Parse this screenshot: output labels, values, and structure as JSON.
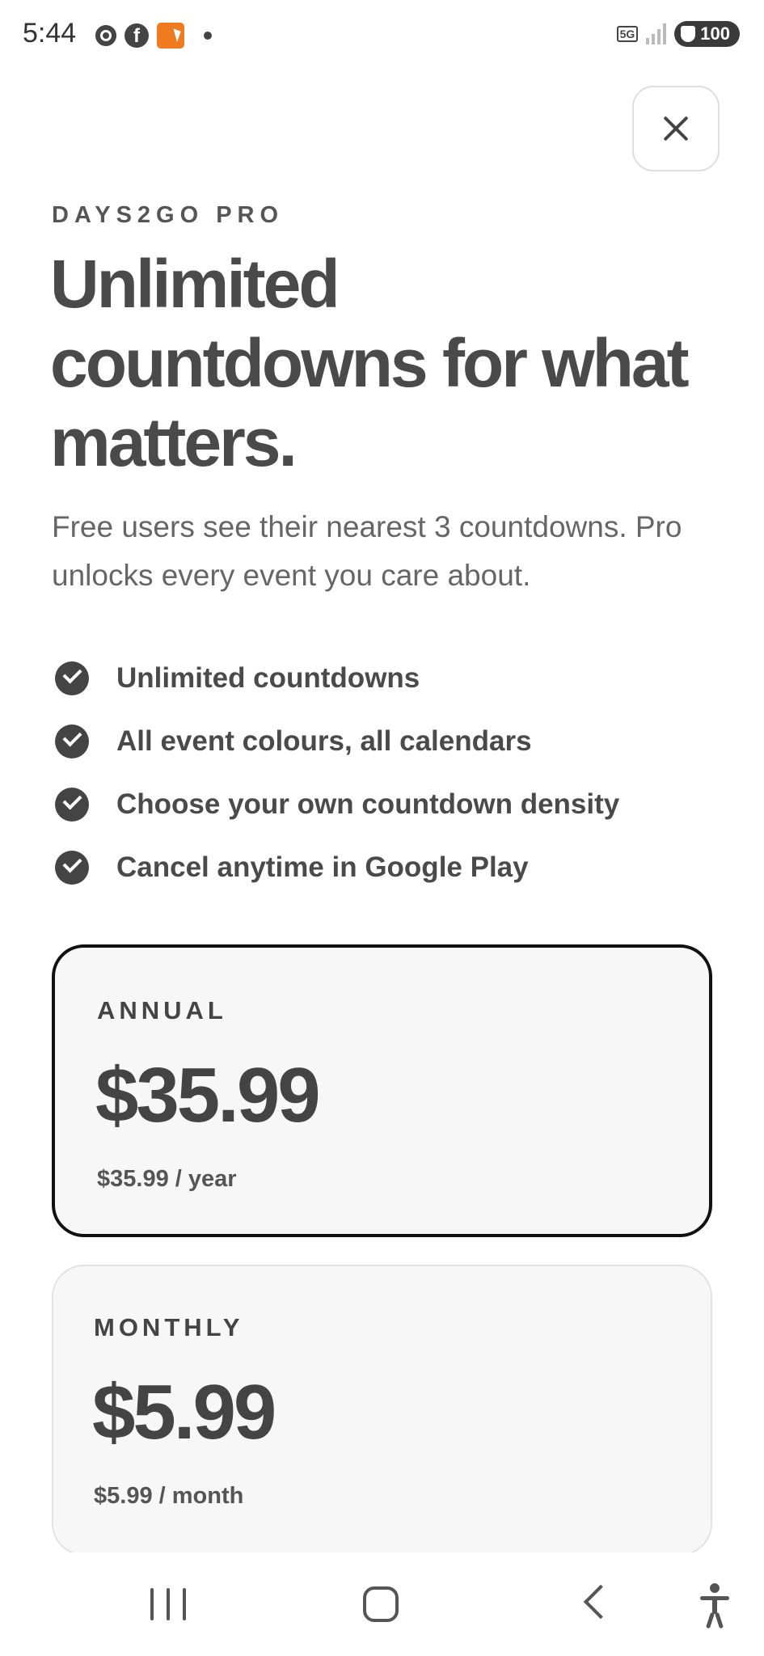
{
  "status_bar": {
    "time": "5:44",
    "network": "5G",
    "battery": "100",
    "icons_left": [
      "chrome-icon",
      "facebook-icon",
      "app-notification-icon",
      "dot-icon"
    ],
    "icons_right": [
      "5g-icon",
      "signal-icon",
      "battery-icon"
    ]
  },
  "paywall": {
    "eyebrow": "DAYS2GO PRO",
    "headline": "Unlimited countdowns for what matters.",
    "subtitle": "Free users see their nearest 3 countdowns. Pro unlocks every event you care about.",
    "features": [
      "Unlimited countdowns",
      "All event colours, all calendars",
      "Choose your own countdown density",
      "Cancel anytime in Google Play"
    ],
    "plans": [
      {
        "name": "ANNUAL",
        "price": "$35.99",
        "period": "$35.99 / year",
        "selected": true
      },
      {
        "name": "MONTHLY",
        "price": "$5.99",
        "period": "$5.99 / month",
        "selected": false
      }
    ]
  },
  "nav_bar": {
    "icons": [
      "recent-apps-icon",
      "home-icon",
      "back-icon",
      "accessibility-icon"
    ]
  }
}
